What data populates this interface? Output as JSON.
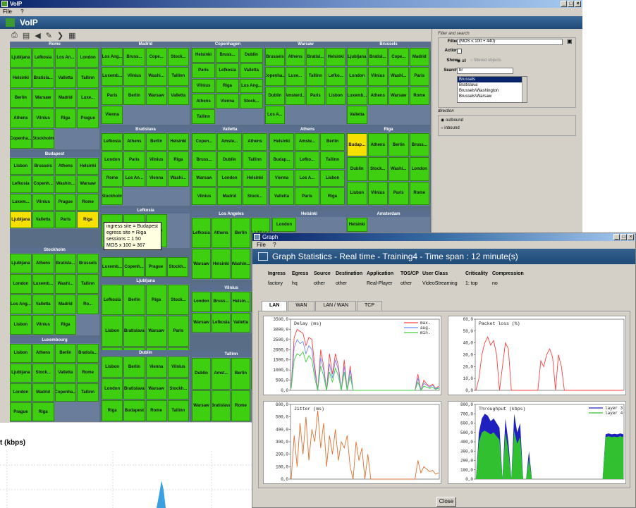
{
  "voip": {
    "title": "VoIP",
    "menu": [
      "File",
      "?"
    ],
    "header": "VoIP"
  },
  "treemap": {
    "colors": {
      "ok": "#3fcf11",
      "warn": "#f5e000",
      "header": "#5a6f8f"
    },
    "cities": [
      {
        "name": "Rome",
        "cells": [
          "Ljubljana",
          "Lefkosia",
          "Los An...",
          "London",
          "Helsinki",
          "Bratisla...",
          "Valletta",
          "Tallinn",
          "Berlin",
          "Warsaw",
          "Madrid",
          "Luxe...",
          "Athens",
          "Vilnius",
          "Riga",
          "Prague",
          "Copenha...",
          "Stockholm"
        ]
      },
      {
        "name": "Madrid",
        "cells": [
          "Los Ang...",
          "Bruss...",
          "Cope...",
          "Stock...",
          "Luxemb...",
          "Vilnius",
          "Washi...",
          "Tallinn",
          "Paris",
          "Berlin",
          "Warsaw",
          "Valletta",
          "Vienna"
        ]
      },
      {
        "name": "Copenhagen",
        "cells": [
          "Helsinki",
          "Bruss...",
          "Dublin",
          "Paris",
          "Lefkosia",
          "Valletta",
          "Vilnius",
          "Riga",
          "Los Ang...",
          "Athens",
          "Vienna",
          "Stock...",
          "Tallinn"
        ]
      },
      {
        "name": "Warsaw",
        "cells": [
          "Brussels",
          "Athens",
          "Bratisl...",
          "Helsinki",
          "Copenha...",
          "Luxe...",
          "Tallinn",
          "Lefko...",
          "Dublin",
          "Amsterd...",
          "Paris",
          "Lisbon",
          "Los A..."
        ]
      },
      {
        "name": "Brussels",
        "cells": [
          "Ljubljana",
          "Bratisl...",
          "Cope...",
          "Madrid",
          "London",
          "Vilnius",
          "Washi...",
          "Paris",
          "Luxemb...",
          "Athens",
          "Warsaw",
          "Rome",
          "Valletta"
        ]
      },
      {
        "name": "Bratislava",
        "cells": [
          "Lefkosia",
          "Athens",
          "Berlin",
          "Helsinki",
          "London",
          "Paris",
          "Vilnius",
          "Riga",
          "Rome",
          "Los An...",
          "Vienna",
          "Washi...",
          "Stockholm"
        ]
      },
      {
        "name": "Valletta",
        "cells": [
          "Copen...",
          "Amste...",
          "Athens",
          "Bruss...",
          "Dublin",
          "Tallinn",
          "Warsaw",
          "London",
          "Helsinki",
          "Vilnius",
          "Madrid",
          "Stock..."
        ]
      },
      {
        "name": "Athens",
        "cells": [
          "Helsinki",
          "Amste...",
          "Berlin",
          "Budap...",
          "Lefko...",
          "Tallinn",
          "Vienna",
          "Los A...",
          "Lisbon",
          "Valletta",
          "Paris",
          "Riga"
        ]
      },
      {
        "name": "Riga",
        "cells": [
          "Budap...",
          "Athens",
          "Berlin",
          "Bruss...",
          "Dublin",
          "Stock...",
          "Washi...",
          "London",
          "Lisbon",
          "Vilnius",
          "Paris",
          "Rome"
        ]
      },
      {
        "name": "Budapest",
        "cells": [
          "Lisbon",
          "Brussels",
          "Athens",
          "Helsinki",
          "Lefkosia",
          "Copenh...",
          "Washin...",
          "Warsaw",
          "Luxem...",
          "Vilnius",
          "Prague",
          "Rome",
          "Ljubljana",
          "Valletta",
          "Paris",
          "Riga"
        ]
      },
      {
        "name": "Lefkosia",
        "cells": [
          "Tallinn",
          "Valletta",
          "Rome"
        ]
      },
      {
        "name": "Los Angeles",
        "cells": [
          "Lefkosia",
          "Athens",
          "Berlin",
          "Ljubljana",
          "Warsaw",
          "Helsinki",
          "Washin..."
        ]
      },
      {
        "name": "Helsinki",
        "cells": [
          "London"
        ]
      },
      {
        "name": "Amsterdam",
        "cells": [
          "Helsinki"
        ]
      },
      {
        "name": "Stockholm",
        "cells": [
          "Ljubljana",
          "Athens",
          "Bratisla...",
          "Brussels",
          "London",
          "Luxemb...",
          "Washi...",
          "Tallinn",
          "Los Ang...",
          "Valletta",
          "Madrid",
          "Ro...",
          "Lisbon",
          "Vilnius",
          "Riga"
        ]
      },
      {
        "name": "Ljubljana",
        "cells": [
          "Lefkosia",
          "Berlin",
          "Riga",
          "Stock...",
          "Lisbon",
          "Bratislava",
          "Warsaw",
          "Paris",
          "Los An...",
          "Budapest",
          "Luxem...",
          "Prague"
        ]
      },
      {
        "name": "Vilnius",
        "cells": [
          "London",
          "Bruss...",
          "Helsin...",
          "Luxemb...",
          "Warsaw",
          "Lefkosia",
          "Valletta"
        ]
      },
      {
        "name": "Luxembourg",
        "cells": [
          "Lisbon",
          "Athens",
          "Berlin",
          "Bratisla...",
          "Ljubljana",
          "Stock...",
          "Valletta",
          "Rome",
          "London",
          "Madrid",
          "Copenha...",
          "Tallinn",
          "Prague",
          "Riga"
        ]
      },
      {
        "name": "Dublin",
        "cells": [
          "Lisbon",
          "Berlin",
          "Vienna",
          "Vilnius",
          "London",
          "Bratislava",
          "Warsaw",
          "Stockh...",
          "Riga",
          "Budapest",
          "Rome",
          "Tallinn"
        ]
      },
      {
        "name": "Tallinn",
        "cells": [
          "Dublin",
          "Amst...",
          "Berlin",
          "Lefkosia",
          "Warsaw",
          "Bratislava",
          "Rome"
        ]
      }
    ],
    "extra_cells": [
      "Luxemb...",
      "Copenh...",
      "Prague",
      "Stockh..."
    ],
    "tooltip": [
      "ingress site = Budapest",
      "egress site = Riga",
      "sessions = 1 50",
      "MOS x 100 = 367"
    ]
  },
  "filter": {
    "section_title": "Filter and search",
    "filter_label": "Filter :",
    "filter_value": "(MOS ≤ 100 + 440)",
    "action_label": "Action :",
    "show_label": "Show :",
    "show_opt1": "all",
    "show_opt2": "filtered objects",
    "search_label": "Search :",
    "search_value": "br",
    "search_results": [
      "Brussels",
      "Bratislava",
      "Brussels\\Washington",
      "Brussels\\Warsaw"
    ],
    "direction_title": "direction",
    "outbound": "outbound",
    "inbound": "inbound"
  },
  "graph": {
    "title": "Graph",
    "menu": [
      "File",
      "?"
    ],
    "header": "Graph Statistics - Real time - Training4 - Time span : 12 minute(s)",
    "info_headers": [
      "Ingress",
      "Egress",
      "Source",
      "Destination",
      "Application",
      "TOS/CP",
      "User Class",
      "Criticality",
      "Compression"
    ],
    "info_values": [
      "factory",
      "hq",
      "other",
      "other",
      "Real-Player",
      "other",
      "VideoStreaming",
      "1: top",
      "no"
    ],
    "tabs": [
      "LAN",
      "WAN",
      "LAN / WAN",
      "TCP"
    ],
    "close_label": "Close"
  },
  "chart_data": [
    {
      "type": "line",
      "title": "Delay (ms)",
      "ylim": [
        0,
        3500
      ],
      "yticks": [
        "3500,0",
        "3000,0",
        "2500,0",
        "2000,0",
        "1500,0",
        "1000,0",
        "500,0",
        "0,0"
      ],
      "series": [
        {
          "name": "max.",
          "color": "#ff4040",
          "values": [
            200,
            2600,
            3000,
            2900,
            2800,
            2200,
            2600,
            2500,
            1200,
            0,
            2000,
            1200,
            0,
            1800,
            800,
            1800,
            1200,
            0,
            1500,
            0,
            1200,
            0,
            0,
            0,
            0,
            0,
            0,
            0,
            0,
            0,
            0,
            0,
            0,
            0,
            0,
            0,
            0,
            0,
            0,
            0,
            0,
            0,
            0,
            800,
            0,
            500,
            300,
            200,
            300,
            100,
            200
          ]
        },
        {
          "name": "aug.",
          "color": "#6b8cff",
          "values": [
            150,
            2100,
            2500,
            2300,
            2400,
            1800,
            2200,
            2000,
            900,
            0,
            1600,
            1000,
            0,
            1300,
            600,
            1500,
            1000,
            0,
            1200,
            0,
            1000,
            0,
            0,
            0,
            0,
            0,
            0,
            0,
            0,
            0,
            0,
            0,
            0,
            0,
            0,
            0,
            0,
            0,
            0,
            0,
            0,
            0,
            0,
            600,
            0,
            350,
            250,
            150,
            250,
            80,
            150
          ]
        },
        {
          "name": "min.",
          "color": "#40d040",
          "values": [
            100,
            1500,
            1800,
            1700,
            1900,
            1400,
            1700,
            1500,
            600,
            0,
            1200,
            700,
            0,
            900,
            400,
            1100,
            700,
            0,
            900,
            0,
            700,
            0,
            0,
            0,
            0,
            0,
            0,
            0,
            0,
            0,
            0,
            0,
            0,
            0,
            0,
            0,
            0,
            0,
            0,
            0,
            0,
            0,
            0,
            400,
            0,
            200,
            150,
            100,
            150,
            50,
            100
          ]
        }
      ]
    },
    {
      "type": "line",
      "title": "Packet loss (%)",
      "ylim": [
        0,
        60
      ],
      "yticks": [
        "60,0",
        "50,0",
        "40,0",
        "30,0",
        "20,0",
        "10,0",
        "0,0"
      ],
      "series": [
        {
          "name": "",
          "color": "#ff4040",
          "values": [
            0,
            10,
            30,
            40,
            45,
            38,
            42,
            30,
            0,
            20,
            40,
            35,
            0,
            0,
            0,
            0,
            0,
            0,
            0,
            0,
            0,
            0,
            25,
            20,
            30,
            35,
            28,
            0,
            30,
            20,
            0,
            0,
            0,
            0,
            0,
            0,
            0,
            0,
            0,
            0,
            0,
            0,
            0,
            0,
            0,
            0,
            0,
            0,
            0,
            0,
            0
          ]
        }
      ]
    },
    {
      "type": "line",
      "title": "Jitter (ms)",
      "ylim": [
        0,
        600
      ],
      "yticks": [
        "600,0",
        "500,0",
        "400,0",
        "300,0",
        "200,0",
        "100,0",
        "0,0"
      ],
      "series": [
        {
          "name": "",
          "color": "#e07030",
          "values": [
            0,
            350,
            100,
            450,
            200,
            500,
            150,
            400,
            300,
            550,
            250,
            450,
            100,
            350,
            200,
            400,
            150,
            300,
            250,
            350,
            100,
            0,
            300,
            150,
            250,
            0,
            200,
            0,
            0,
            0,
            0,
            0,
            0,
            0,
            0,
            0,
            0,
            0,
            0,
            0,
            0,
            0,
            0,
            150,
            50,
            100,
            80,
            60,
            70,
            40,
            50
          ]
        }
      ]
    },
    {
      "type": "area",
      "title": "Throughput (kbps)",
      "ylim": [
        0,
        800
      ],
      "yticks": [
        "800,0",
        "700,0",
        "600,0",
        "500,0",
        "400,0",
        "300,0",
        "200,0",
        "100,0",
        "0,0"
      ],
      "series": [
        {
          "name": "layer 3",
          "color": "#2020c0",
          "values": [
            0,
            500,
            650,
            700,
            680,
            620,
            650,
            600,
            550,
            0,
            650,
            400,
            0,
            700,
            500,
            600,
            0,
            0,
            300,
            0,
            0,
            0,
            0,
            0,
            0,
            0,
            0,
            0,
            0,
            0,
            0,
            0,
            0,
            0,
            0,
            0,
            0,
            0,
            0,
            0,
            0,
            0,
            0,
            0,
            480,
            490,
            480,
            485,
            480,
            490,
            480
          ]
        },
        {
          "name": "layer 4",
          "color": "#30c030",
          "values": [
            0,
            400,
            500,
            520,
            500,
            480,
            500,
            460,
            420,
            0,
            500,
            300,
            0,
            520,
            380,
            450,
            0,
            0,
            220,
            0,
            0,
            0,
            0,
            0,
            0,
            0,
            0,
            0,
            0,
            0,
            0,
            0,
            0,
            0,
            0,
            0,
            0,
            0,
            0,
            0,
            0,
            0,
            0,
            0,
            450,
            460,
            450,
            455,
            450,
            460,
            450
          ]
        }
      ]
    }
  ],
  "background": {
    "label": "t (kbps)"
  }
}
